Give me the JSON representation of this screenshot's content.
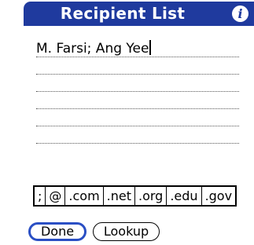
{
  "header": {
    "title": "Recipient List",
    "info_icon": "info-icon",
    "info_glyph": "i"
  },
  "recipients": {
    "value": "M. Farsi; Ang Yee"
  },
  "shortcuts": [
    ";",
    "@",
    ".com",
    ".net",
    ".org",
    ".edu",
    ".gov"
  ],
  "buttons": {
    "done_label": "Done",
    "lookup_label": "Lookup"
  },
  "colors": {
    "title_bar": "#1f3a9e",
    "default_button_border": "#2a4fc4"
  }
}
